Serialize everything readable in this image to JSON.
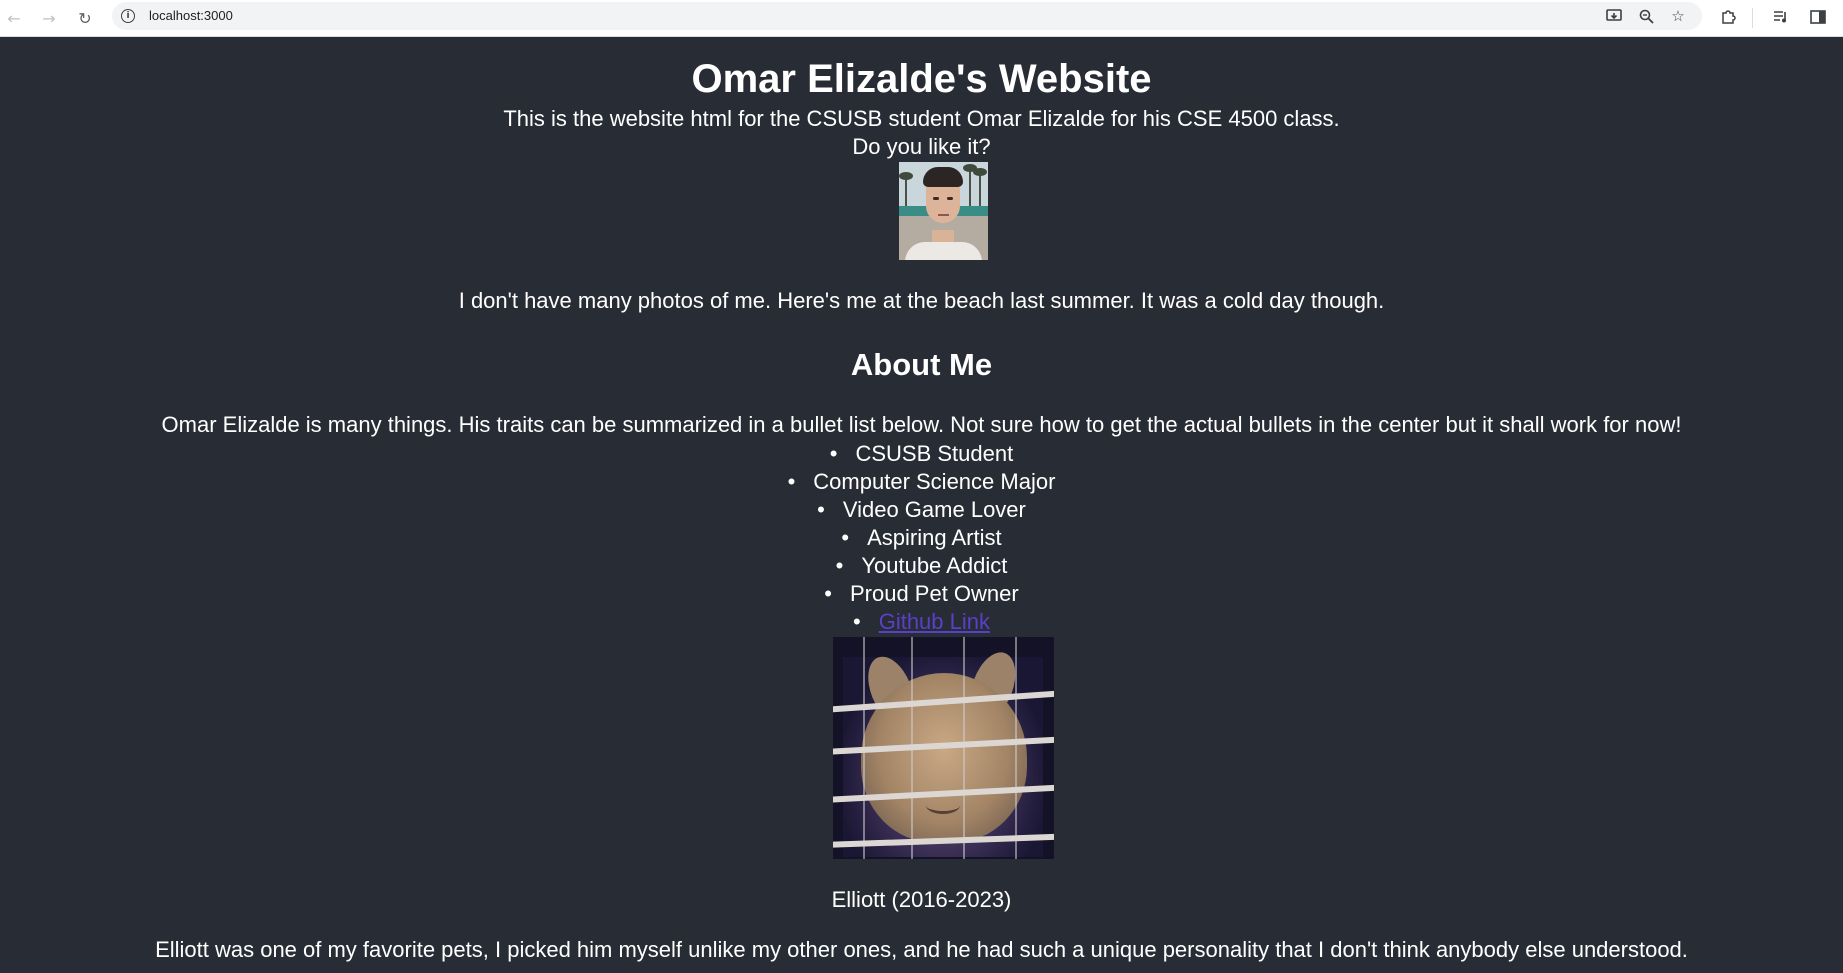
{
  "browser": {
    "url": "localhost:3000",
    "icons": {
      "back": "back-arrow-icon",
      "forward": "forward-arrow-icon",
      "reload": "reload-icon",
      "site_info": "info-icon",
      "cast": "cast-icon",
      "zoom": "zoom-icon",
      "bookmark": "star-icon",
      "extensions": "puzzle-icon",
      "media": "media-queue-icon",
      "side_panel": "side-panel-icon"
    }
  },
  "page": {
    "background": "#282c34",
    "title": "Omar Elizalde's Website",
    "intro_line1": "This is the website html for the CSUSB student Omar Elizalde for his CSE 4500 class.",
    "intro_line2": "Do you like it?",
    "photo_caption": "I don't have many photos of me. Here's me at the beach last summer. It was a cold day though.",
    "about_heading": "About Me",
    "about_text": "Omar Elizalde is many things. His traits can be summarized in a bullet list below. Not sure how to get the actual bullets in the center but it shall work for now!",
    "traits": [
      "CSUSB Student",
      "Computer Science Major",
      "Video Game Lover",
      "Aspiring Artist",
      "Youtube Addict",
      "Proud Pet Owner"
    ],
    "github_link": "Github Link",
    "link_color": "#5a3fc8",
    "pet_caption": "Elliott (2016-2023)",
    "pet_text": "Elliott was one of my favorite pets, I picked him myself unlike my other ones, and he had such a unique personality that I don't think anybody else understood."
  }
}
